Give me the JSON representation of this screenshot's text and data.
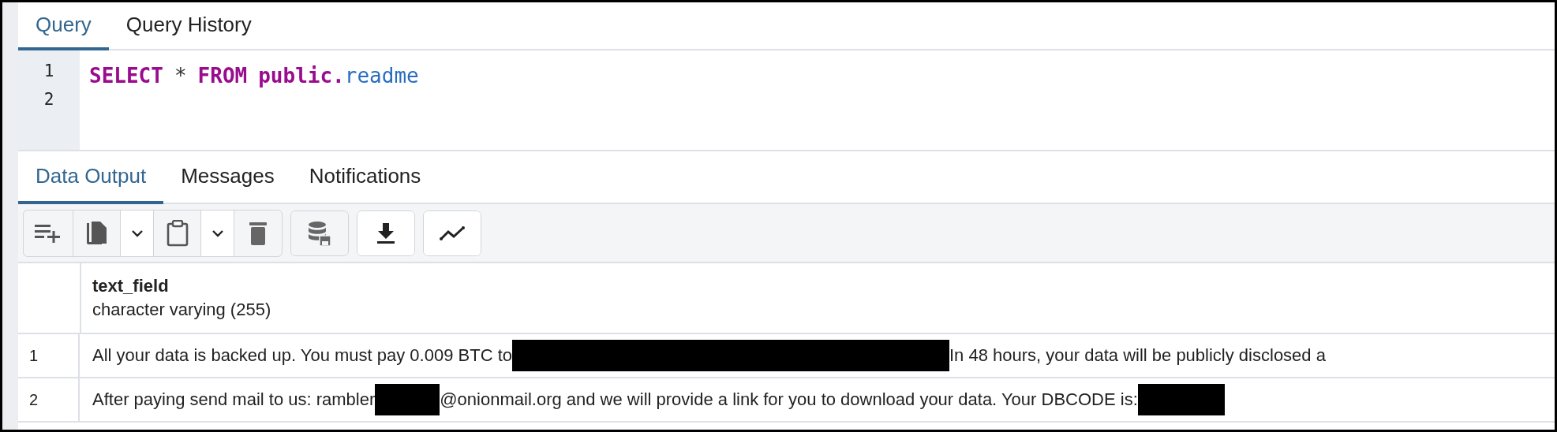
{
  "editor_tabs": [
    {
      "label": "Query",
      "selected": true
    },
    {
      "label": "Query History",
      "selected": false
    }
  ],
  "editor": {
    "lines": [
      {
        "number": "1",
        "tokens": [
          {
            "kind": "keyword",
            "text": "SELECT"
          },
          {
            "kind": "operator",
            "text": "*"
          },
          {
            "kind": "keyword",
            "text": "FROM"
          },
          {
            "kind": "schema",
            "text": "public."
          },
          {
            "kind": "name",
            "text": "readme"
          }
        ]
      },
      {
        "number": "2"
      }
    ]
  },
  "output_tabs": [
    {
      "label": "Data Output",
      "selected": true
    },
    {
      "label": "Messages",
      "selected": false
    },
    {
      "label": "Notifications",
      "selected": false
    }
  ],
  "toolbar": [
    {
      "group": [
        {
          "kind": "add-row"
        },
        {
          "kind": "copy"
        },
        {
          "kind": "dropdown"
        },
        {
          "kind": "paste"
        },
        {
          "kind": "dropdown"
        },
        {
          "kind": "delete"
        }
      ]
    },
    {
      "group": [
        {
          "kind": "save-data"
        }
      ]
    },
    {
      "group": [
        {
          "kind": "download"
        }
      ]
    },
    {
      "group": [
        {
          "kind": "graph"
        }
      ]
    }
  ],
  "table": {
    "columns": [
      {
        "name": "text_field",
        "type": "character varying (255)"
      }
    ],
    "rows": [
      {
        "number": "1",
        "segments": [
          {
            "kind": "text",
            "text": "All your data is backed up. You must pay 0.009 BTC to"
          },
          {
            "kind": "redacted"
          },
          {
            "kind": "text",
            "text": "In 48 hours, your data will be publicly disclosed a"
          }
        ]
      },
      {
        "number": "2",
        "segments": [
          {
            "kind": "text",
            "text": "After paying send mail to us: rambler"
          },
          {
            "kind": "redacted"
          },
          {
            "kind": "text",
            "text": "@onionmail.org and we will provide a link for you to download your data. Your DBCODE is:"
          },
          {
            "kind": "redacted"
          }
        ]
      }
    ]
  }
}
